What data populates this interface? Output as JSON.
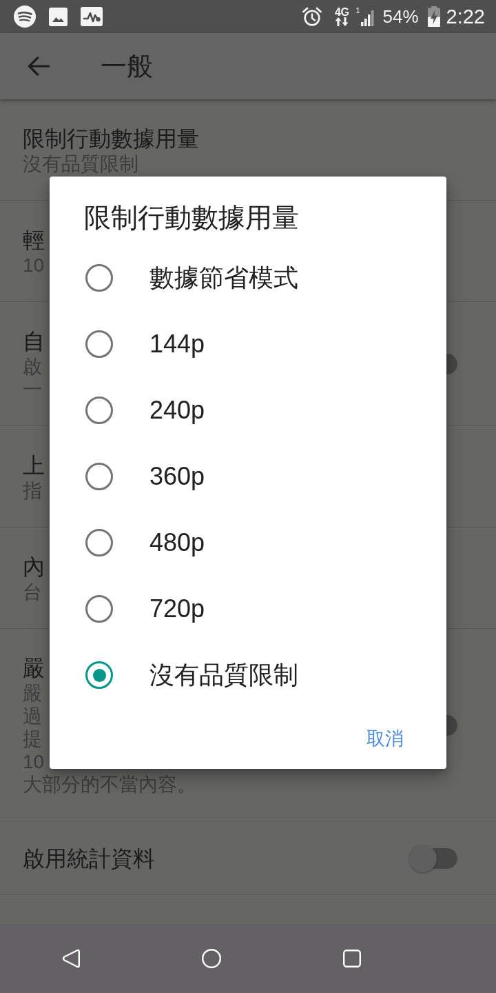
{
  "status_bar": {
    "network_type": "4G",
    "sim_label": "1",
    "battery": "54%",
    "time": "2:22"
  },
  "app_bar": {
    "title": "一般"
  },
  "settings": [
    {
      "kind": "plain",
      "title": "限制行動數據用量",
      "subtitle_lines": [
        "沒有品質限制"
      ]
    },
    {
      "kind": "plain",
      "title": "輕",
      "subtitle_lines": [
        "10"
      ]
    },
    {
      "kind": "switch",
      "title": "自",
      "subtitle_lines": [
        "啟",
        "一"
      ],
      "on": false
    },
    {
      "kind": "plain",
      "title": "上",
      "subtitle_lines": [
        "指"
      ]
    },
    {
      "kind": "plain",
      "title": "內",
      "subtitle_lines": [
        "台"
      ]
    },
    {
      "kind": "switch",
      "title": "嚴",
      "subtitle_lines": [
        "嚴",
        "過",
        "提",
        "10",
        "大部分的不當內容。"
      ],
      "on": false
    },
    {
      "kind": "switch",
      "title": "啟用統計資料",
      "on": false
    }
  ],
  "dialog": {
    "title": "限制行動數據用量",
    "options": [
      {
        "label": "數據節省模式",
        "selected": false
      },
      {
        "label": "144p",
        "selected": false
      },
      {
        "label": "240p",
        "selected": false
      },
      {
        "label": "360p",
        "selected": false
      },
      {
        "label": "480p",
        "selected": false
      },
      {
        "label": "720p",
        "selected": false
      },
      {
        "label": "沒有品質限制",
        "selected": true
      }
    ],
    "buttons": [
      "取消"
    ]
  }
}
